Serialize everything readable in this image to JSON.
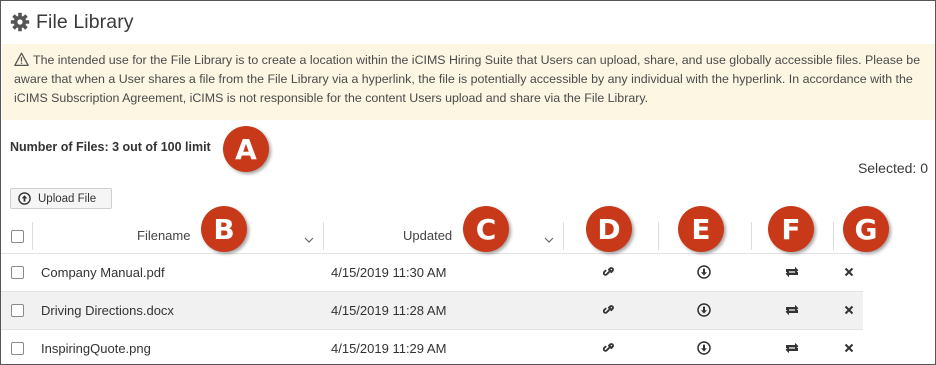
{
  "page": {
    "title": "File Library",
    "title_icon": "gear-icon",
    "notice_icon": "warning-icon",
    "notice": "The intended use for the File Library is to create a location within the iCIMS Hiring Suite that Users can upload, share, and use globally accessible files. Please be aware that when a User shares a file from the File Library via a hyperlink, the file is potentially accessible by any individual with the hyperlink. In accordance with the iCIMS Subscription Agreement, iCIMS is not responsible for the content Users upload and share via the File Library."
  },
  "summary": {
    "file_count": "Number of Files: 3 out of 100 limit",
    "selected": "Selected: 0"
  },
  "toolbar": {
    "upload_label": "Upload File",
    "upload_icon": "upload-circle-icon"
  },
  "table": {
    "columns": {
      "filename": "Filename",
      "updated": "Updated"
    },
    "rows": [
      {
        "filename": "Company Manual.pdf",
        "updated": "4/15/2019 11:30 AM"
      },
      {
        "filename": "Driving Directions.docx",
        "updated": "4/15/2019 11:28 AM"
      },
      {
        "filename": "InspiringQuote.png",
        "updated": "4/15/2019 11:29 AM"
      }
    ],
    "row_actions": [
      "link-icon",
      "download-icon",
      "replace-icon",
      "delete-icon"
    ]
  },
  "callouts": {
    "a": "A",
    "b": "B",
    "c": "C",
    "d": "D",
    "e": "E",
    "f": "F",
    "g": "G"
  },
  "colors": {
    "callout": "#c8391a",
    "notice_bg": "#fcf6e3",
    "alt_row": "#f1f1f1"
  }
}
